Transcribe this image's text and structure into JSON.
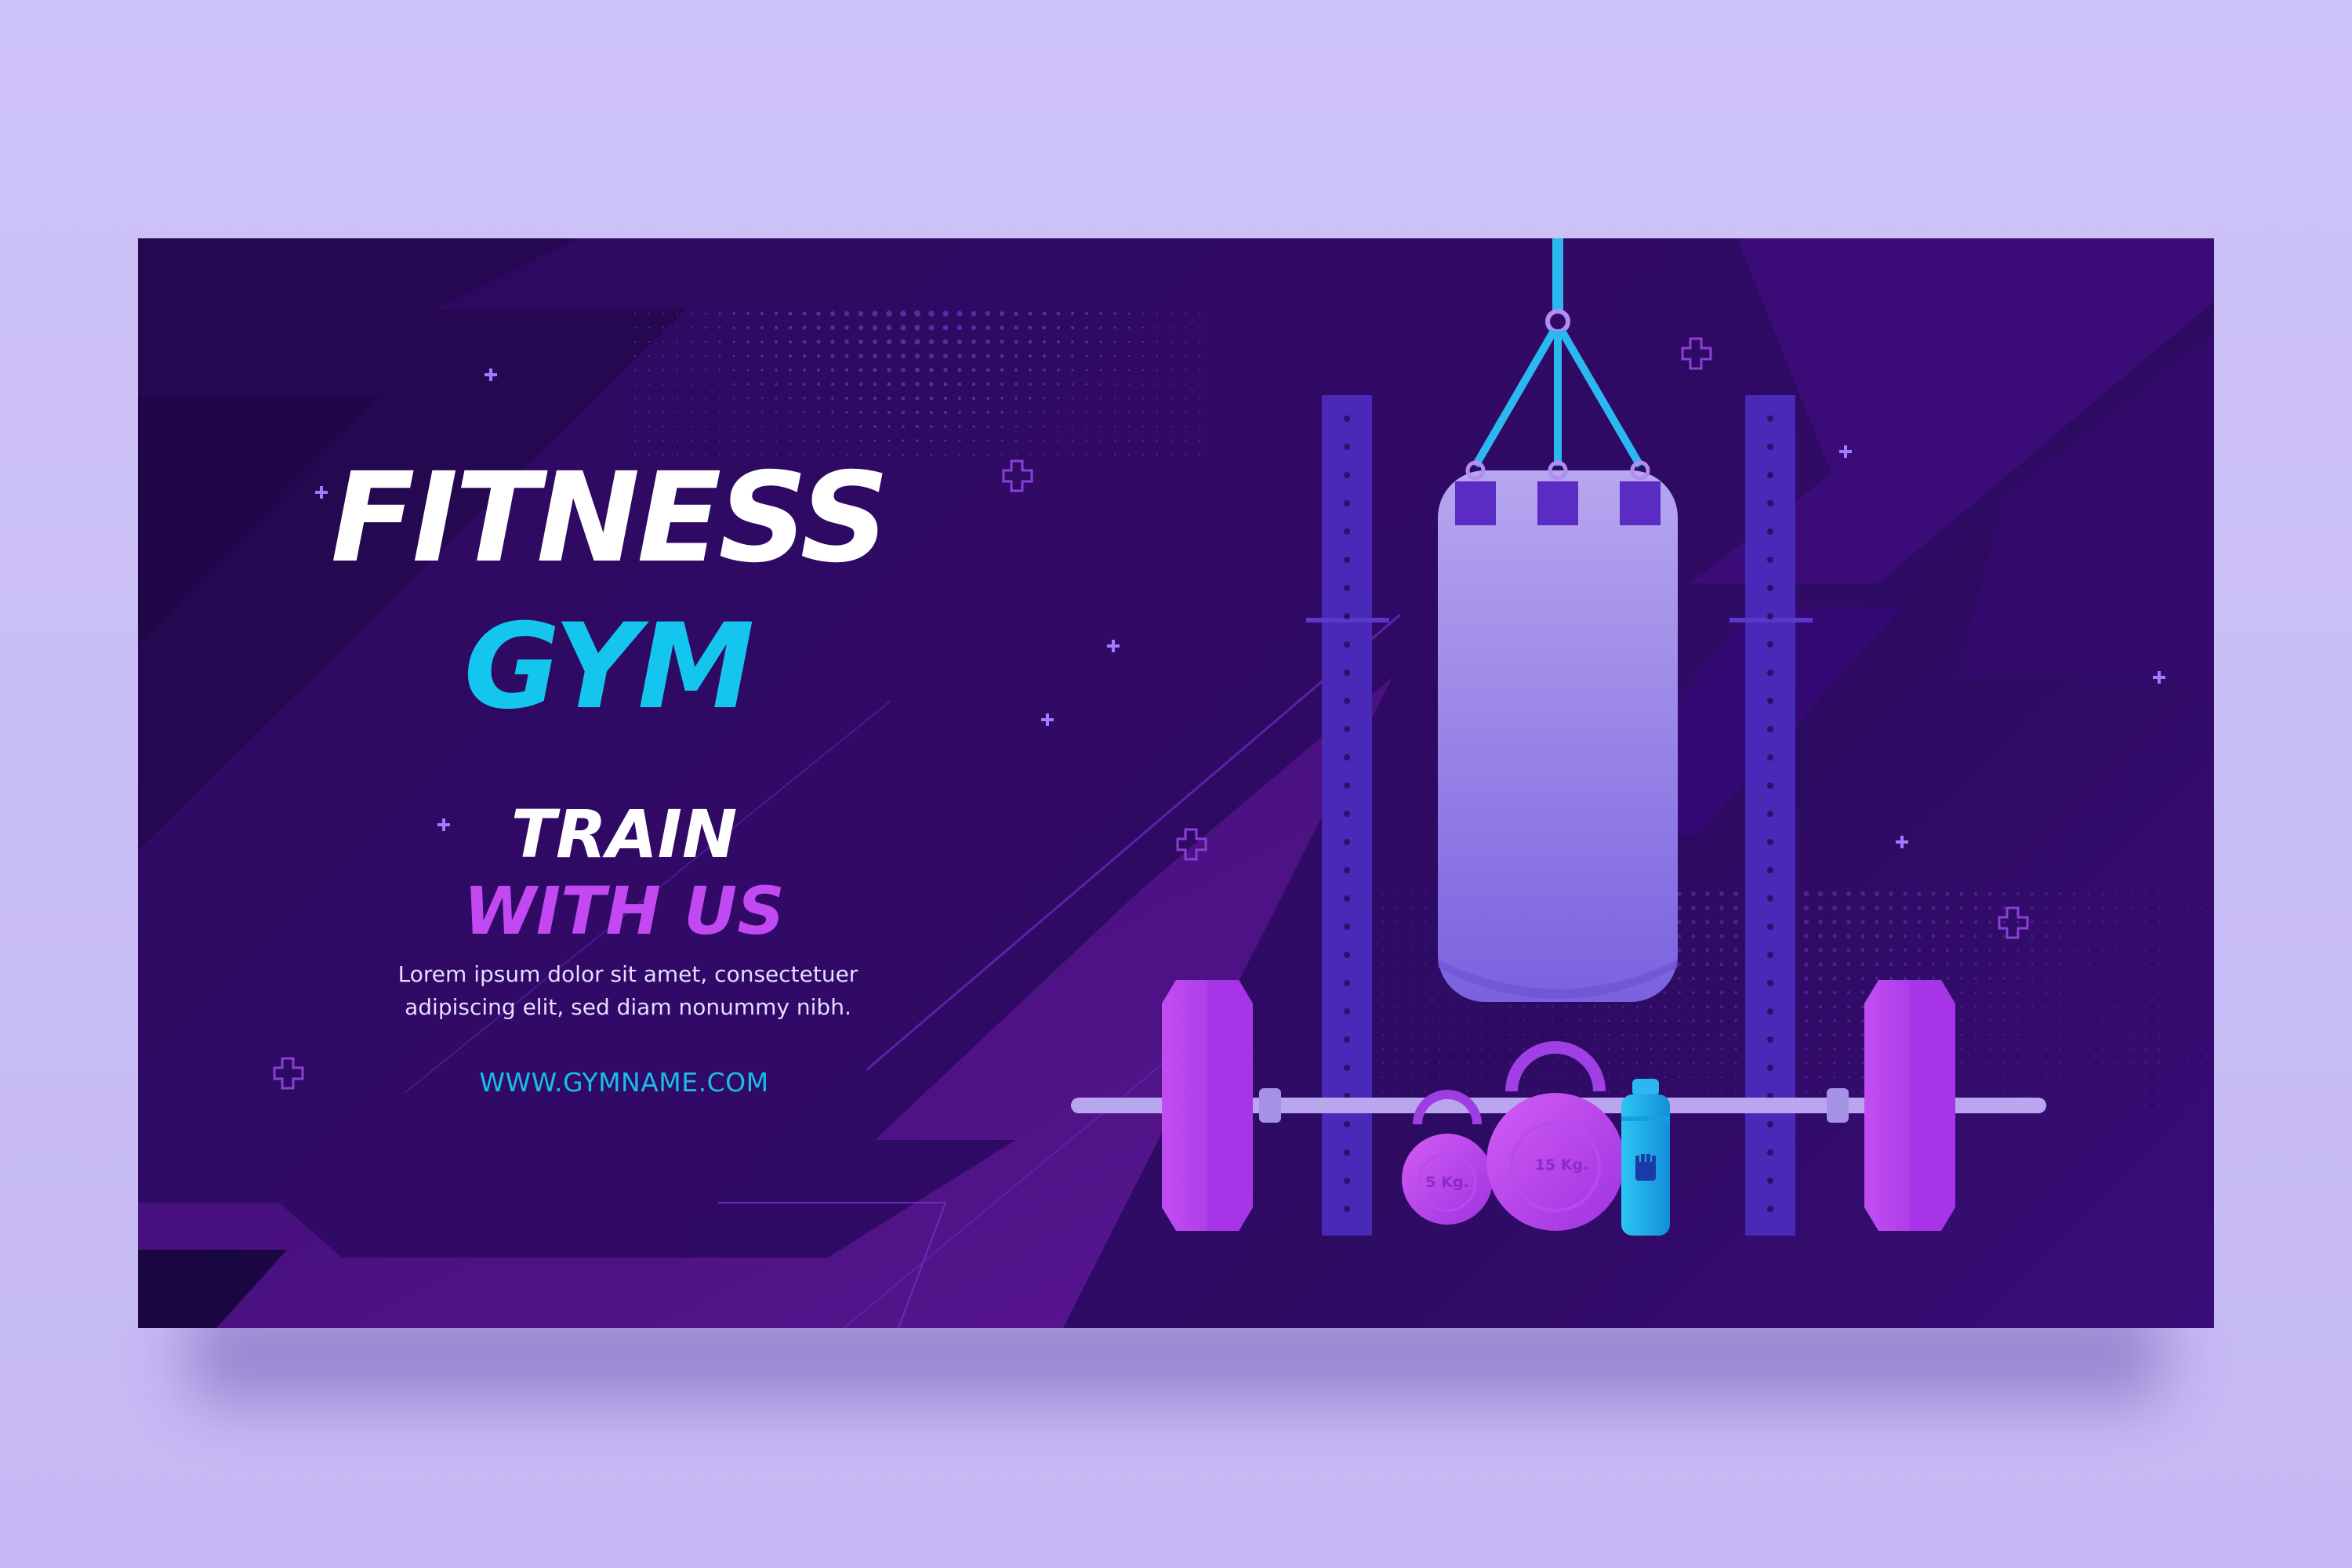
{
  "banner": {
    "headline_line1": "FITNESS",
    "headline_line2": "GYM",
    "tagline_line1": "TRAIN",
    "tagline_line2": "WITH US",
    "body_text": "Lorem ipsum dolor sit amet, consectetuer adipiscing elit, sed diam nonummy nibh.",
    "website": "WWW.GYMNAME.COM"
  },
  "equipment": {
    "small_kettlebell_label": "5 Kg.",
    "large_kettlebell_label": "15 Kg."
  },
  "colors": {
    "page_background": "#cdc2f7",
    "banner_background": "#2e0b63",
    "headline_accent": "#14c6ee",
    "tagline_accent": "#c249f2",
    "text_primary": "#ffffff"
  },
  "icons": [
    "plus-sparkle-icon",
    "punching-bag-icon",
    "barbell-icon",
    "kettlebell-icon",
    "water-bottle-icon",
    "fist-icon"
  ]
}
